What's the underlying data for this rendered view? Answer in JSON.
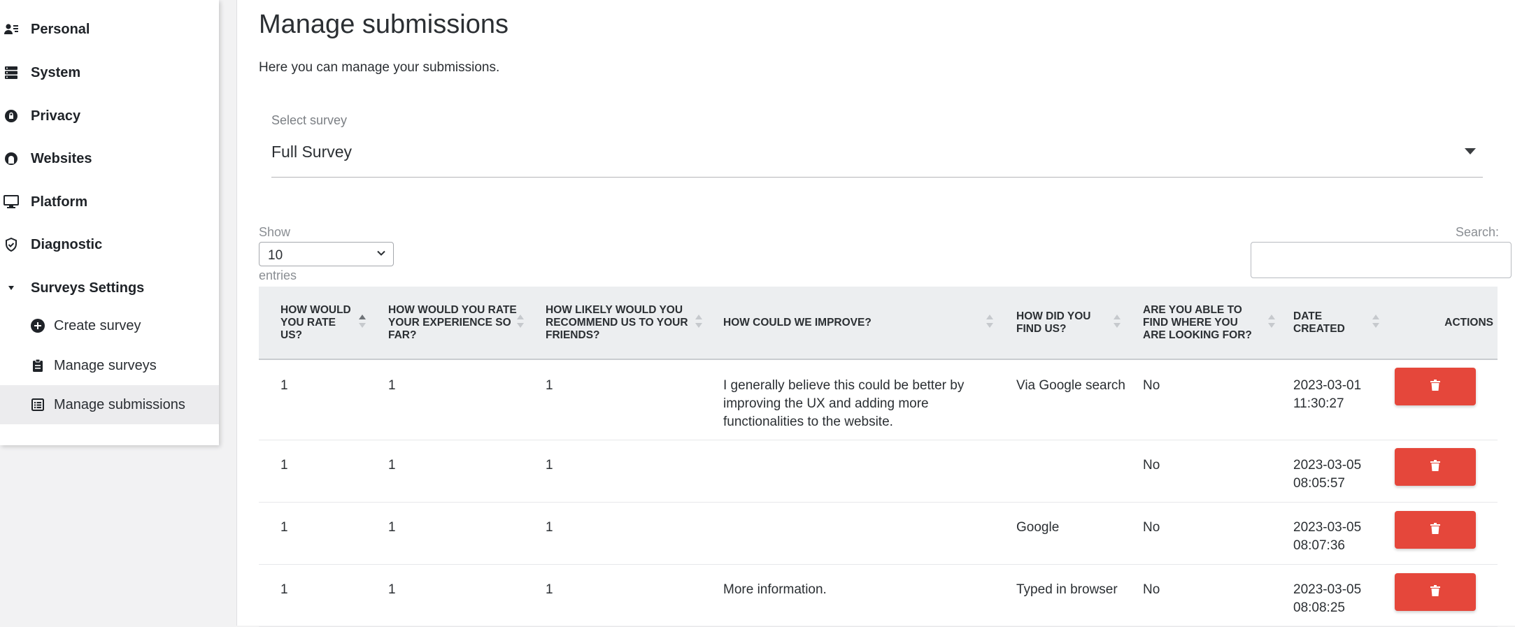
{
  "sidebar": {
    "items": [
      {
        "label": "Personal",
        "icon": "user-card-icon"
      },
      {
        "label": "System",
        "icon": "server-icon"
      },
      {
        "label": "Privacy",
        "icon": "lock-icon"
      },
      {
        "label": "Websites",
        "icon": "globe-icon"
      },
      {
        "label": "Platform",
        "icon": "monitor-icon"
      },
      {
        "label": "Diagnostic",
        "icon": "shield-check-icon"
      },
      {
        "label": "Surveys Settings",
        "icon": "caret-down-icon"
      }
    ],
    "subitems": [
      {
        "label": "Create survey",
        "icon": "plus-circle-icon"
      },
      {
        "label": "Manage surveys",
        "icon": "clipboard-icon"
      },
      {
        "label": "Manage submissions",
        "icon": "list-icon",
        "active": true
      }
    ]
  },
  "main": {
    "title": "Manage submissions",
    "description": "Here you can manage your submissions.",
    "survey_select": {
      "label": "Select survey",
      "value": "Full Survey"
    },
    "length": {
      "show": "Show",
      "value": "10",
      "entries": "entries"
    },
    "search": {
      "label": "Search:",
      "value": ""
    }
  },
  "table": {
    "headers": [
      "How would you rate us?",
      "How would you rate your experience so far?",
      "How likely would you recommend us to your friends?",
      "How could we improve?",
      "How did you find us?",
      "Are you able to find where you are looking for?",
      "Date created",
      "Actions"
    ],
    "rows": [
      {
        "c0": "1",
        "c1": "1",
        "c2": "1",
        "c3": "I generally believe this could be better by improving the UX and adding more functionalities to the website.",
        "c4": "Via Google search",
        "c5": "No",
        "c6": "2023-03-01 11:30:27"
      },
      {
        "c0": "1",
        "c1": "1",
        "c2": "1",
        "c3": "",
        "c4": "",
        "c5": "No",
        "c6": "2023-03-05 08:05:57"
      },
      {
        "c0": "1",
        "c1": "1",
        "c2": "1",
        "c3": "",
        "c4": "Google",
        "c5": "No",
        "c6": "2023-03-05 08:07:36"
      },
      {
        "c0": "1",
        "c1": "1",
        "c2": "1",
        "c3": "More information.",
        "c4": "Typed in browser",
        "c5": "No",
        "c6": "2023-03-05 08:08:25"
      }
    ]
  },
  "colors": {
    "delete_button": "#e5473b",
    "header_bg": "#eceef0"
  }
}
